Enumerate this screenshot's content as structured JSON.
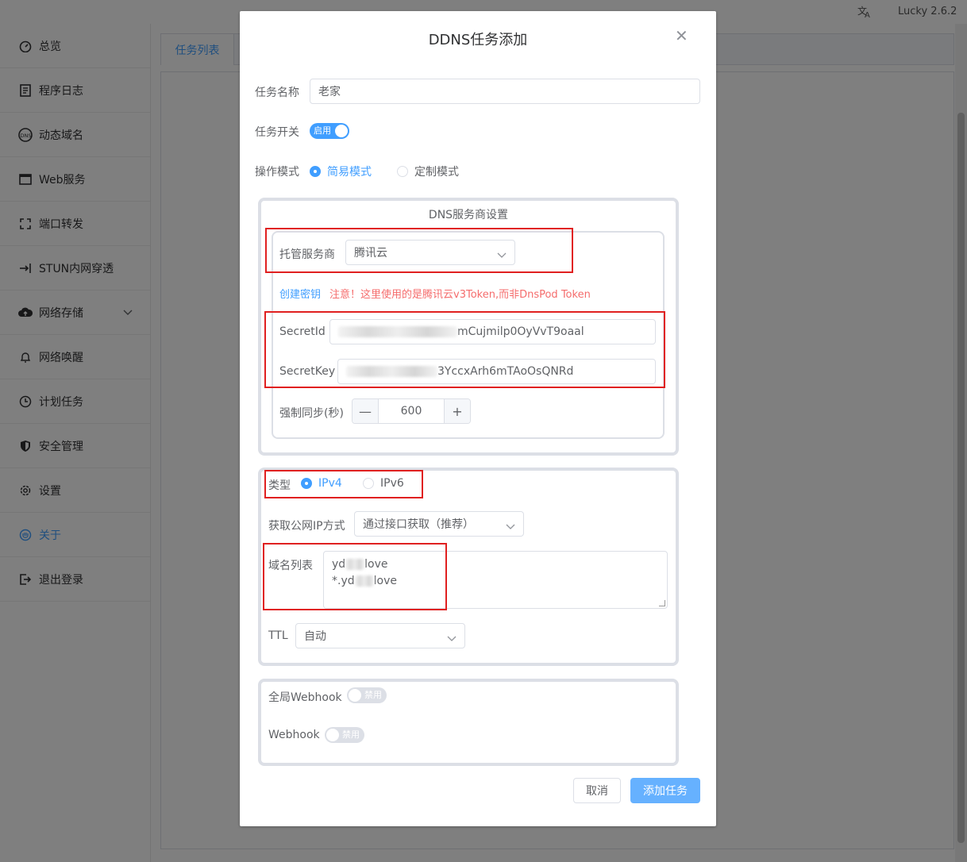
{
  "topbar": {
    "translate_icon": "translate-icon",
    "version": "Lucky 2.6.2"
  },
  "sidebar": {
    "items": [
      {
        "label": "总览",
        "icon": "dashboard-icon"
      },
      {
        "label": "程序日志",
        "icon": "log-icon"
      },
      {
        "label": "动态域名",
        "icon": "dns-icon"
      },
      {
        "label": "Web服务",
        "icon": "web-icon"
      },
      {
        "label": "端口转发",
        "icon": "port-forward-icon"
      },
      {
        "label": "STUN内网穿透",
        "icon": "stun-icon"
      },
      {
        "label": "网络存储",
        "icon": "cloud-storage-icon"
      },
      {
        "label": "网络唤醒",
        "icon": "bell-icon"
      },
      {
        "label": "计划任务",
        "icon": "clock-icon"
      },
      {
        "label": "安全管理",
        "icon": "shield-icon"
      },
      {
        "label": "设置",
        "icon": "gear-icon"
      },
      {
        "label": "关于",
        "icon": "about-icon"
      },
      {
        "label": "退出登录",
        "icon": "logout-icon"
      }
    ],
    "active": "关于"
  },
  "main": {
    "tab_label": "任务列表"
  },
  "dialog": {
    "title": "DDNS任务添加",
    "name_label": "任务名称",
    "name_value": "老家",
    "switch_label": "任务开关",
    "switch_text": "启用",
    "mode_label": "操作模式",
    "mode_options": [
      "简易模式",
      "定制模式"
    ],
    "mode_selected": "简易模式",
    "dns_legend": "DNS服务商设置",
    "provider_label": "托管服务商",
    "provider_value": "腾讯云",
    "create_key_link": "创建密钥",
    "warning": "注意！这里使用的是腾讯云v3Token,而非DnsPod Token",
    "secret_id_label": "SecretId",
    "secret_id_visible": "mCujmilp0OyVvT9oaal",
    "secret_key_label": "SecretKey",
    "secret_key_visible": "3YccxArh6mTAoOsQNRd",
    "sync_label": "强制同步(秒)",
    "sync_minus": "—",
    "sync_value": "600",
    "sync_plus": "+",
    "type_label": "类型",
    "type_options": [
      "IPv4",
      "IPv6"
    ],
    "type_selected": "IPv4",
    "ip_method_label": "获取公网IP方式",
    "ip_method_value": "通过接口获取（推荐）",
    "domains_label": "域名列表",
    "domain_1_prefix": "yd",
    "domain_1_suffix": "love",
    "domain_2_prefix": "*.yd",
    "domain_2_suffix": "love",
    "ttl_label": "TTL",
    "ttl_value": "自动",
    "global_webhook_label": "全局Webhook",
    "global_webhook_text": "禁用",
    "webhook_label": "Webhook",
    "webhook_text": "禁用",
    "cancel_label": "取消",
    "submit_label": "添加任务"
  },
  "colors": {
    "accent": "#409eff",
    "warning": "#f56c6c",
    "highlight_box": "#e02020"
  }
}
